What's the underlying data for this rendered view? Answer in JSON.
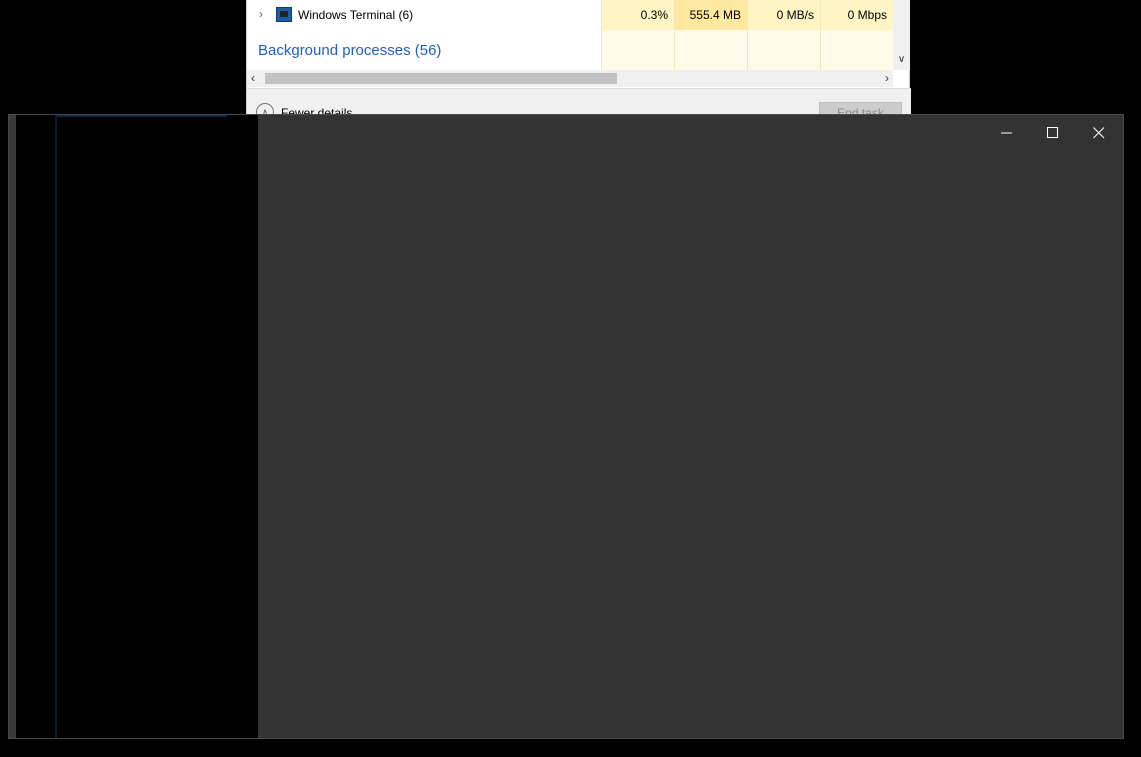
{
  "task_manager": {
    "processes": [
      {
        "name": "Windows Terminal (6)",
        "icon": "terminal-icon",
        "cpu": "0.3%",
        "memory": "555.4 MB",
        "disk": "0 MB/s",
        "network": "0 Mbps"
      }
    ],
    "group_label": "Background processes (56)",
    "footer": {
      "fewer_details_label": "Fewer details",
      "end_task_label": "End task"
    },
    "colors": {
      "group_label": "#1f5fbf",
      "cell_highlight": "#fff4c4",
      "memory_highlight": "#ffe8a0"
    }
  },
  "dark_window": {
    "background": "#333333",
    "controls": {
      "minimize": "minimize-icon",
      "maximize": "maximize-icon",
      "close": "close-icon"
    }
  }
}
